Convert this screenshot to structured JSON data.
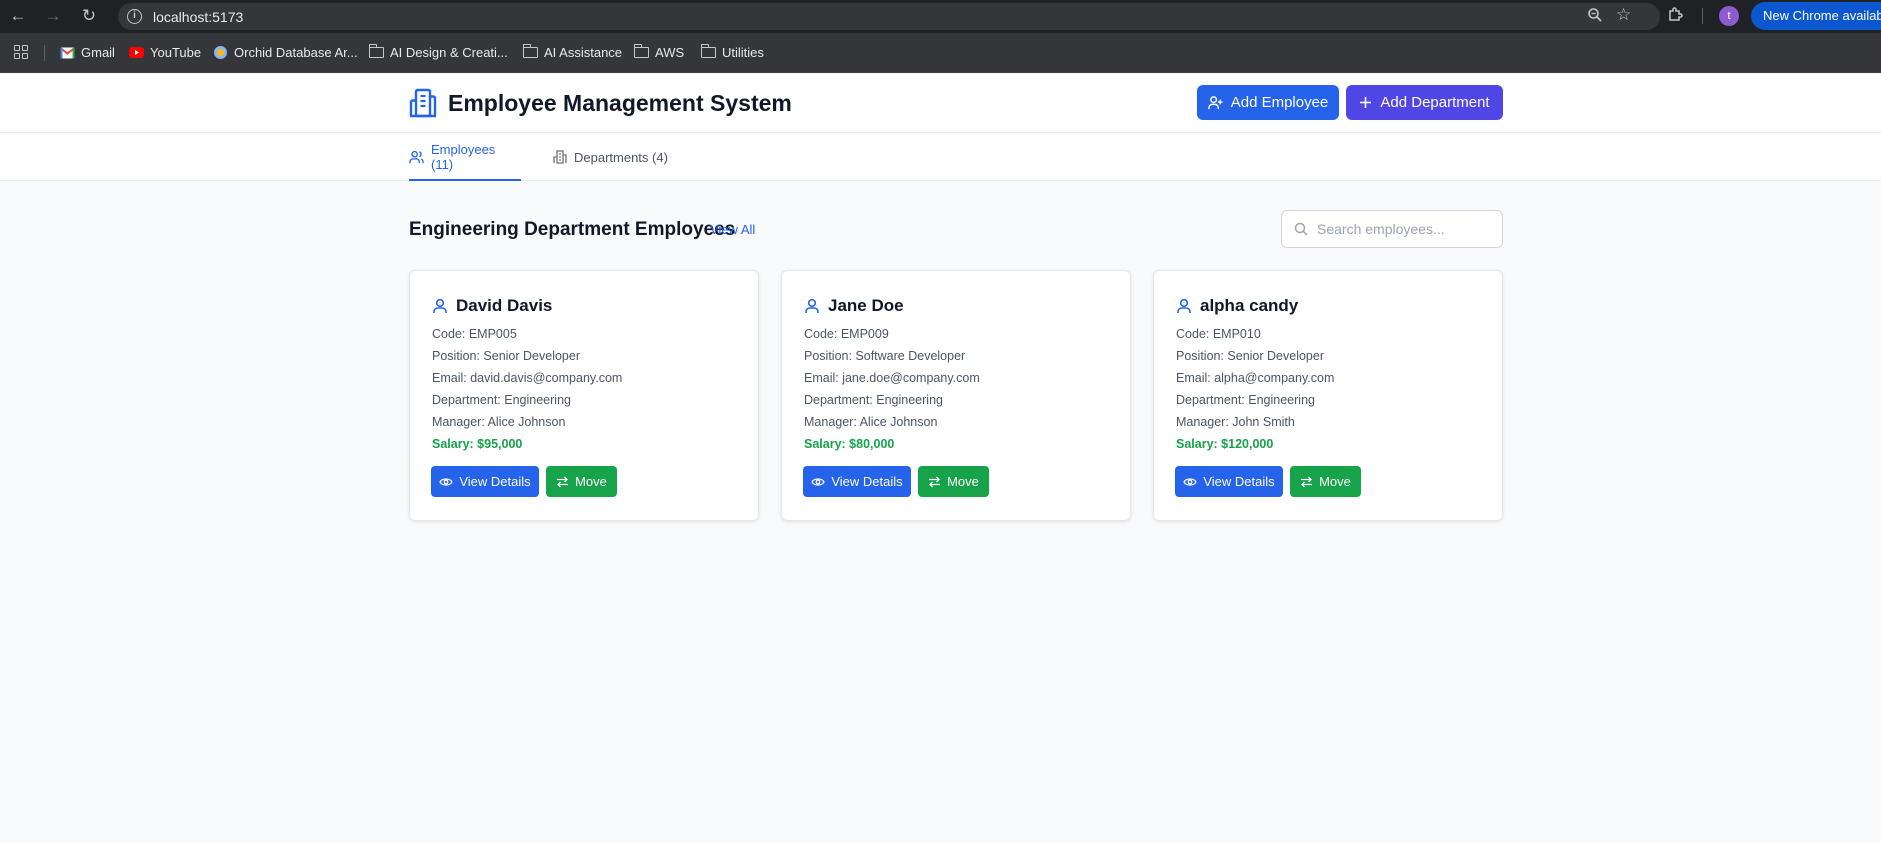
{
  "browser": {
    "url": "localhost:5173",
    "update_label": "New Chrome available",
    "profile_initial": "t",
    "bookmarks": [
      {
        "label": "Gmail",
        "icon": "gmail-icon"
      },
      {
        "label": "YouTube",
        "icon": "youtube-icon"
      },
      {
        "label": "Orchid Database Ar...",
        "icon": "globe-icon"
      },
      {
        "label": "AI Design & Creati...",
        "icon": "folder-icon"
      },
      {
        "label": "AI Assistance",
        "icon": "folder-icon"
      },
      {
        "label": "AWS",
        "icon": "folder-icon"
      },
      {
        "label": "Utilities",
        "icon": "folder-icon"
      }
    ]
  },
  "header": {
    "title": "Employee Management System",
    "add_employee_label": "Add Employee",
    "add_department_label": "Add Department"
  },
  "tabs": [
    {
      "label": "Employees (11)",
      "active": true
    },
    {
      "label": "Departments (4)",
      "active": false
    }
  ],
  "section": {
    "title": "Engineering Department Employees",
    "view_all_label": "View All"
  },
  "search": {
    "placeholder": "Search employees...",
    "value": ""
  },
  "employees": [
    {
      "name": "David Davis",
      "code": "Code: EMP005",
      "position": "Position: Senior Developer",
      "email": "Email: david.davis@company.com",
      "department": "Department: Engineering",
      "manager": "Manager: Alice Johnson",
      "salary": "Salary: $95,000"
    },
    {
      "name": "Jane Doe",
      "code": "Code: EMP009",
      "position": "Position: Software Developer",
      "email": "Email: jane.doe@company.com",
      "department": "Department: Engineering",
      "manager": "Manager: Alice Johnson",
      "salary": "Salary: $80,000"
    },
    {
      "name": "alpha candy",
      "code": "Code: EMP010",
      "position": "Position: Senior Developer",
      "email": "Email: alpha@company.com",
      "department": "Department: Engineering",
      "manager": "Manager: John Smith",
      "salary": "Salary: $120,000"
    }
  ],
  "card_actions": {
    "view_label": "View Details",
    "move_label": "Move"
  },
  "colors": {
    "primary": "#2563eb",
    "indigo": "#4f46e5",
    "success": "#16a34a",
    "background": "#f8fafc"
  }
}
